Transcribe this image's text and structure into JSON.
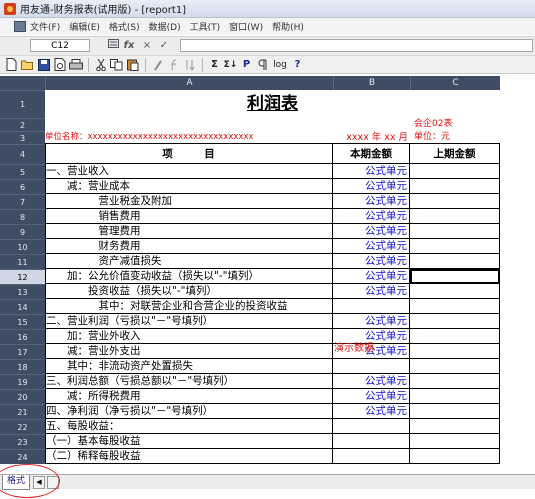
{
  "window": {
    "title": "用友通-财务报表(试用版) - [report1]"
  },
  "menu": [
    "文件(F)",
    "编辑(E)",
    "格式(S)",
    "数据(D)",
    "工具(T)",
    "窗口(W)",
    "帮助(H)"
  ],
  "formula_bar": {
    "cell_ref": "C12",
    "fx_symbol": "fx",
    "cancel_symbol": "×",
    "accept_symbol": "✓"
  },
  "toolbar": {
    "bold_symbol": "P",
    "sum_symbol": "Σ",
    "sort_symbol": "Σ↓",
    "log_symbol": "log",
    "help_symbol": "?"
  },
  "columns": [
    "A",
    "B",
    "C"
  ],
  "rows": [
    {
      "n": "1",
      "a": "",
      "b": "",
      "c": ""
    },
    {
      "n": "2",
      "a": "",
      "b": "",
      "c": "会企02表"
    },
    {
      "n": "3",
      "a": "单位名称：xxxxxxxxxxxxxxxxxxxxxxxxxxxxxxxxx",
      "b": "xxxx 年 xx 月",
      "c": "单位：元"
    },
    {
      "n": "4",
      "a": "项　　　目",
      "b": "本期金额",
      "c": "上期金额"
    },
    {
      "n": "5",
      "a": "一、营业收入",
      "b": "公式单元",
      "c": ""
    },
    {
      "n": "6",
      "a": "　　减：营业成本",
      "b": "公式单元",
      "c": ""
    },
    {
      "n": "7",
      "a": "　　　　　营业税金及附加",
      "b": "公式单元",
      "c": ""
    },
    {
      "n": "8",
      "a": "　　　　　销售费用",
      "b": "公式单元",
      "c": ""
    },
    {
      "n": "9",
      "a": "　　　　　管理费用",
      "b": "公式单元",
      "c": ""
    },
    {
      "n": "10",
      "a": "　　　　　财务费用",
      "b": "公式单元",
      "c": ""
    },
    {
      "n": "11",
      "a": "　　　　　资产减值损失",
      "b": "公式单元",
      "c": ""
    },
    {
      "n": "12",
      "a": "　　加：公允价值变动收益（损失以\"-\"填列）",
      "b": "公式单元",
      "c": ""
    },
    {
      "n": "13",
      "a": "　　　　投资收益（损失以\"-\"填列）",
      "b": "公式单元",
      "c": ""
    },
    {
      "n": "14",
      "a": "　　　　　其中：对联营企业和合营企业的投资收益",
      "b": "",
      "c": ""
    },
    {
      "n": "15",
      "a": "二、营业利润（亏损以\"－\"号填列）",
      "b": "公式单元",
      "c": ""
    },
    {
      "n": "16",
      "a": "　　加：营业外收入",
      "b": "公式单元",
      "c": ""
    },
    {
      "n": "17",
      "a": "　　减：营业外支出",
      "b": "公式单元",
      "c": ""
    },
    {
      "n": "18",
      "a": "　　其中：非流动资产处置损失",
      "b": "",
      "c": ""
    },
    {
      "n": "19",
      "a": "三、利润总额（亏损总额以\"－\"号填列）",
      "b": "公式单元",
      "c": ""
    },
    {
      "n": "20",
      "a": "　　减：所得税费用",
      "b": "公式单元",
      "c": ""
    },
    {
      "n": "21",
      "a": "四、净利润（净亏损以\"－\"号填列）",
      "b": "公式单元",
      "c": ""
    },
    {
      "n": "22",
      "a": "五、每股收益：",
      "b": "",
      "c": ""
    },
    {
      "n": "23",
      "a": "（一）基本每股收益",
      "b": "",
      "c": ""
    },
    {
      "n": "24",
      "a": "（二）稀释每股收益",
      "b": "",
      "c": ""
    }
  ],
  "report_title": "利润表",
  "demo_overlay": "演示数据",
  "sheet_tab": "格式",
  "annotation_color": "#e02020"
}
